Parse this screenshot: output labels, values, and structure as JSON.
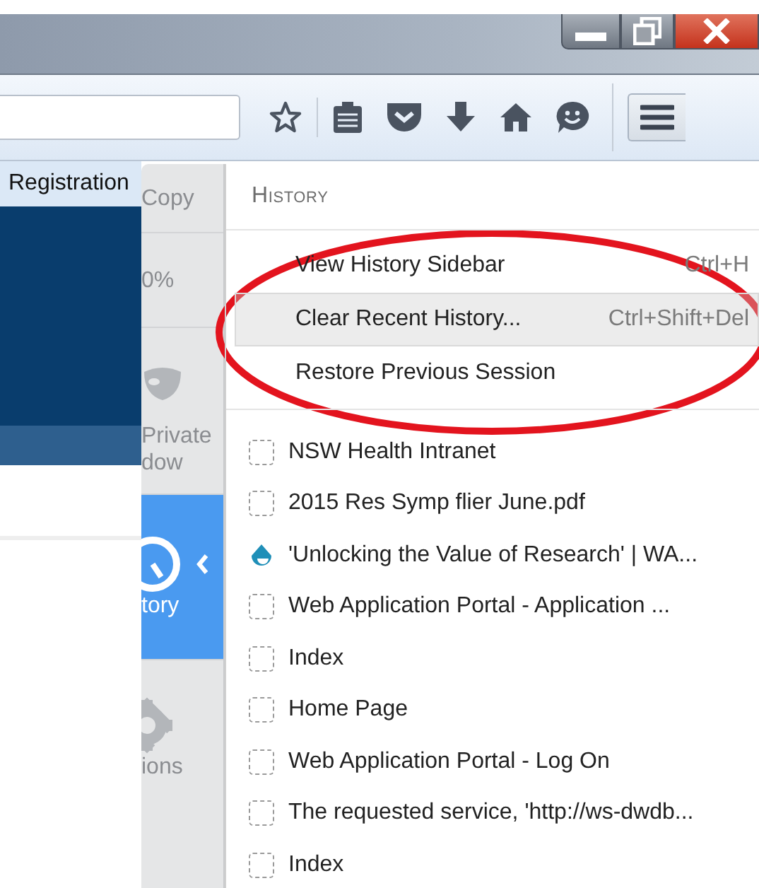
{
  "page": {
    "tab_label": "Registration"
  },
  "menu_strip": [
    {
      "kind": "copy",
      "label": "Copy",
      "selected": false
    },
    {
      "kind": "zoom",
      "label": "0%",
      "selected": false
    },
    {
      "kind": "private",
      "label": "Private",
      "label_2": "dow",
      "selected": false
    },
    {
      "kind": "history",
      "label": "tory",
      "selected": true
    },
    {
      "kind": "options",
      "label": "ions",
      "selected": false
    }
  ],
  "history_panel": {
    "title": "History",
    "actions": [
      {
        "label": "View History Sidebar",
        "shortcut": "Ctrl+H",
        "highlighted": false
      },
      {
        "label": "Clear Recent History...",
        "shortcut": "Ctrl+Shift+Del",
        "highlighted": true
      },
      {
        "label": "Restore Previous Session",
        "highlighted": false
      }
    ],
    "items": [
      {
        "kind": "blank",
        "label": "NSW Health Intranet"
      },
      {
        "kind": "blank",
        "label": "2015 Res Symp flier June.pdf"
      },
      {
        "kind": "favicon",
        "label": "'Unlocking the Value of Research' | WA..."
      },
      {
        "kind": "blank",
        "label": "Web Application Portal - Application ..."
      },
      {
        "kind": "blank",
        "label": "Index"
      },
      {
        "kind": "blank",
        "label": "Home Page"
      },
      {
        "kind": "blank",
        "label": "Web Application Portal - Log On"
      },
      {
        "kind": "blank",
        "label": "The requested service, 'http://ws-dwdb..."
      },
      {
        "kind": "blank",
        "label": "Index"
      }
    ]
  }
}
